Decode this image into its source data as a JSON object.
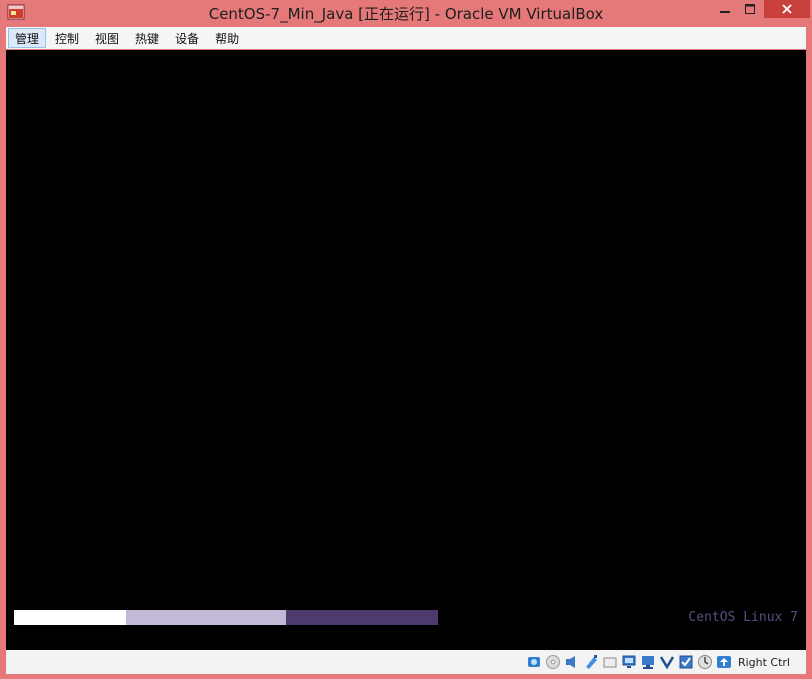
{
  "window": {
    "title": "CentOS-7_Min_Java [正在运行] - Oracle VM VirtualBox",
    "icon": "virtualbox-app-icon",
    "controls": {
      "minimize_glyph": "—",
      "maximize_glyph": "□",
      "close_glyph": "✕"
    }
  },
  "menu": {
    "items": [
      {
        "label": "管理",
        "active": true
      },
      {
        "label": "控制",
        "active": false
      },
      {
        "label": "视图",
        "active": false
      },
      {
        "label": "热键",
        "active": false
      },
      {
        "label": "设备",
        "active": false
      },
      {
        "label": "帮助",
        "active": false
      }
    ]
  },
  "screen": {
    "background": "#000000",
    "boot_progress": {
      "segments": [
        {
          "share": 0.264,
          "color": "#ffffff"
        },
        {
          "share": 0.377,
          "color": "#c3b9d6"
        },
        {
          "share": 0.359,
          "color": "#4e3b6e"
        }
      ]
    },
    "distro_label": "CentOS Linux 7",
    "distro_color": "#5d4b83"
  },
  "statusbar": {
    "icons": [
      "hard-disk-icon",
      "optical-drive-icon",
      "audio-icon",
      "usb-icon",
      "shared-folders-icon",
      "display-icon",
      "network-icon",
      "video-capture-icon",
      "virtualization-icon",
      "mouse-integration-icon",
      "keyboard-capture-icon"
    ],
    "host_key": "Right Ctrl"
  },
  "colors": {
    "titlebar": "#e57878",
    "close_button": "#c7403b",
    "menubar": "#f5f5f5",
    "menu_active": "#dbe9f8",
    "statusbar": "#f3f3f3"
  }
}
